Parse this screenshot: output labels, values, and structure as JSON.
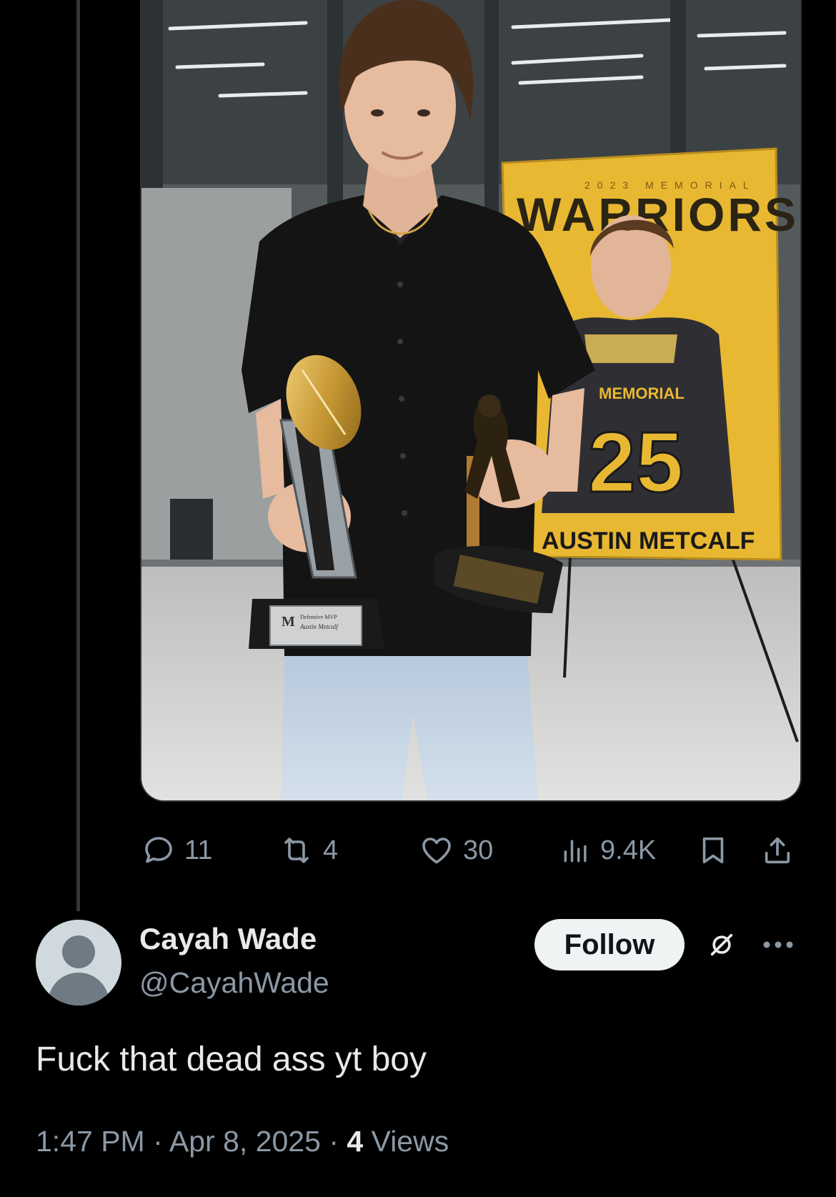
{
  "media": {
    "banner": {
      "kicker": "2023 MEMORIAL",
      "title": "WARRIORS",
      "jersey_text": "MEMORIAL",
      "jersey_number": "25",
      "player_name": "AUSTIN METCALF"
    },
    "trophy_plaque": {
      "line1": "Defensive MVP",
      "line2": "Austin Metcalf"
    }
  },
  "actions": {
    "replies": "11",
    "reposts": "4",
    "likes": "30",
    "views": "9.4K"
  },
  "reply": {
    "display_name": "Cayah Wade",
    "handle": "@CayahWade",
    "follow_label": "Follow",
    "text": "Fuck that dead ass yt boy",
    "time": "1:47 PM",
    "date": "Apr 8, 2025",
    "views_count": "4",
    "views_label": "Views",
    "separator": "·"
  },
  "colors": {
    "background": "#000000",
    "primary_text": "#e7e9ea",
    "secondary_text": "#8b98a5",
    "banner_yellow": "#e9b832"
  }
}
